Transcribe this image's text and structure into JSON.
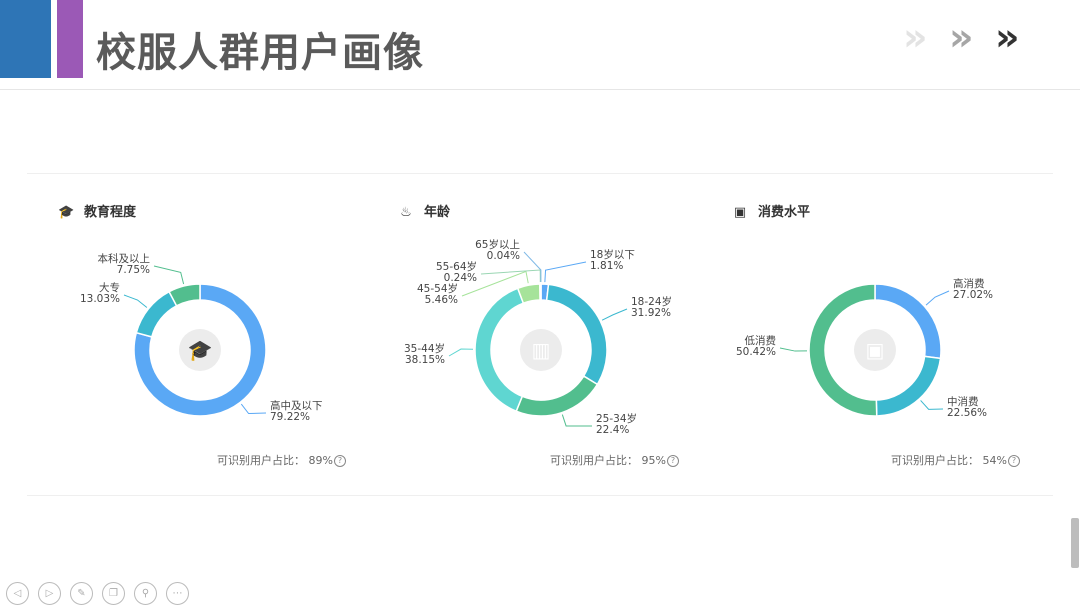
{
  "page": {
    "title": "校服人群用户画像"
  },
  "header": {
    "chevron_glyph": "»",
    "chevron_colors": [
      "#e3e3e3",
      "#a6a6a6",
      "#333333"
    ]
  },
  "chart_data": [
    {
      "type": "pie",
      "donut": true,
      "title": "教育程度",
      "icon": "graduation-cap-icon",
      "categories": [
        "高中及以下",
        "大专",
        "本科及以上"
      ],
      "values": [
        79.22,
        13.03,
        7.75
      ],
      "value_labels": [
        "79.22%",
        "13.03%",
        "7.75%"
      ],
      "colors": [
        "#5aa8f5",
        "#3bb8cf",
        "#52be8e"
      ],
      "footer_label": "可识别用户占比：",
      "footer_value": "89%"
    },
    {
      "type": "pie",
      "donut": true,
      "title": "年龄",
      "icon": "cake-icon",
      "categories": [
        "18岁以下",
        "18-24岁",
        "25-34岁",
        "35-44岁",
        "45-54岁",
        "55-64岁",
        "65岁以上"
      ],
      "values": [
        1.81,
        31.92,
        22.4,
        38.15,
        5.46,
        0.24,
        0.04
      ],
      "value_labels": [
        "1.81%",
        "31.92%",
        "22.4%",
        "38.15%",
        "5.46%",
        "0.24%",
        "0.04%"
      ],
      "colors": [
        "#5aa8f5",
        "#3bb8cf",
        "#52be8e",
        "#5fd6d1",
        "#a6e39a",
        "#9ad6b3",
        "#7fb9e6"
      ],
      "footer_label": "可识别用户占比：",
      "footer_value": "95%"
    },
    {
      "type": "pie",
      "donut": true,
      "title": "消费水平",
      "icon": "wallet-icon",
      "categories": [
        "高消费",
        "中消费",
        "低消费"
      ],
      "values": [
        27.02,
        22.56,
        50.42
      ],
      "value_labels": [
        "27.02%",
        "22.56%",
        "50.42%"
      ],
      "colors": [
        "#5aa8f5",
        "#3bb8cf",
        "#52be8e"
      ],
      "footer_label": "可识别用户占比：",
      "footer_value": "54%"
    }
  ],
  "nav_controls": [
    {
      "name": "prev-slide-button",
      "glyph": "◁"
    },
    {
      "name": "next-slide-button",
      "glyph": "▷"
    },
    {
      "name": "pen-tool-button",
      "glyph": "✎"
    },
    {
      "name": "slides-overview-button",
      "glyph": "❐"
    },
    {
      "name": "zoom-button",
      "glyph": "⚲"
    },
    {
      "name": "more-options-button",
      "glyph": "⋯"
    }
  ]
}
